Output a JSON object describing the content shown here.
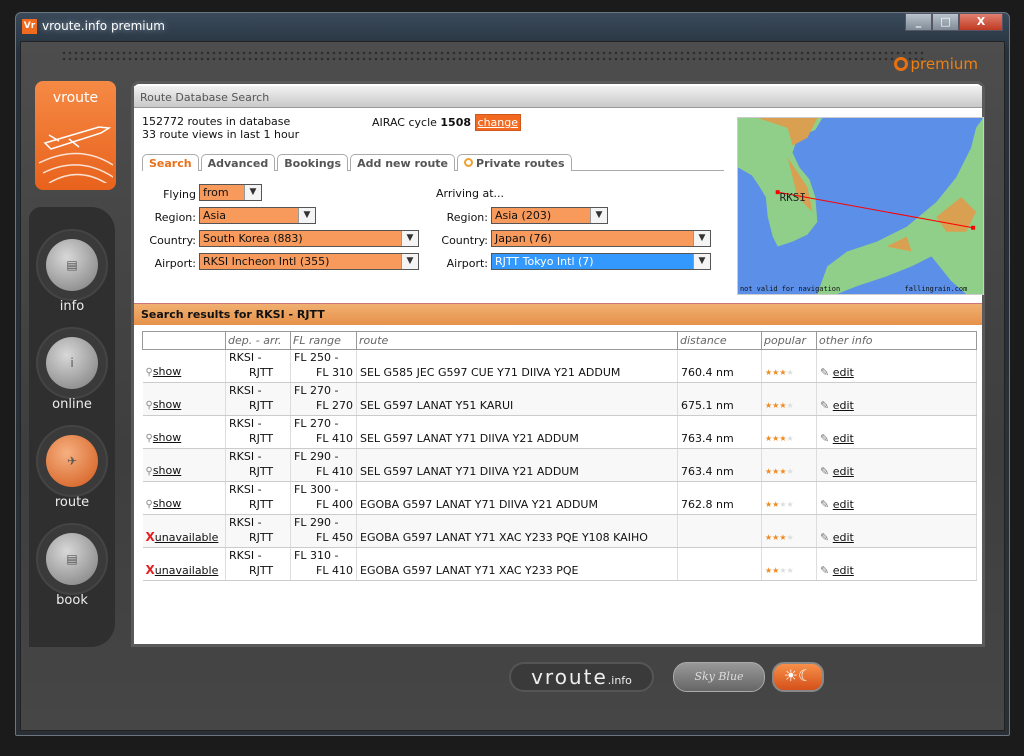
{
  "window": {
    "title": "vroute.info premium",
    "app_icon": "Vr",
    "min": "_",
    "max": "□",
    "close": "X"
  },
  "brand": {
    "premium": "premium",
    "tile": "vroute"
  },
  "nav": [
    {
      "label": "info",
      "icon": "info-book-icon",
      "glyph": "▤"
    },
    {
      "label": "online",
      "icon": "online-info-icon",
      "glyph": "i"
    },
    {
      "label": "route",
      "icon": "route-plane-icon",
      "glyph": "✈"
    },
    {
      "label": "book",
      "icon": "book-icon",
      "glyph": "▤"
    }
  ],
  "panel": {
    "title": "Route Database Search",
    "routes_count": "152772 routes in database",
    "views": "33 route views in last 1 hour",
    "airac_label": "AIRAC cycle",
    "airac_cycle": "1508",
    "change": "change"
  },
  "tabs": [
    "Search",
    "Advanced",
    "Bookings",
    "Add new route",
    "Private routes"
  ],
  "form": {
    "flying_label": "Flying",
    "flying_value": "from",
    "arriving_label": "Arriving at...",
    "region_label": "Region:",
    "country_label": "Country:",
    "airport_label": "Airport:",
    "dep_region": "Asia",
    "dep_country": "South Korea (883)",
    "dep_airport": "RKSI Incheon Intl (355)",
    "arr_region": "Asia (203)",
    "arr_country": "Japan (76)",
    "arr_airport": "RJTT Tokyo Intl (7)"
  },
  "map": {
    "label": "RKSI",
    "disclaimer": "not valid for navigation",
    "credit": "fallingrain.com"
  },
  "results": {
    "title": "Search results for RKSI - RJTT",
    "columns": [
      "",
      "dep. - arr.",
      "FL range",
      "route",
      "distance",
      "popular",
      "other info"
    ],
    "rows": [
      {
        "action": "show",
        "dep": "RKSI -",
        "arr": "RJTT",
        "fl_from": "FL 250 -",
        "fl_to": "FL 310",
        "route": "SEL G585 JEC G597 CUE Y71 DIIVA Y21 ADDUM",
        "distance": "760.4 nm",
        "stars": 3,
        "edit": "edit"
      },
      {
        "action": "show",
        "dep": "RKSI -",
        "arr": "RJTT",
        "fl_from": "FL 270 -",
        "fl_to": "FL 270",
        "route": "SEL G597 LANAT Y51 KARUI",
        "distance": "675.1 nm",
        "stars": 3,
        "edit": "edit"
      },
      {
        "action": "show",
        "dep": "RKSI -",
        "arr": "RJTT",
        "fl_from": "FL 270 -",
        "fl_to": "FL 410",
        "route": "SEL G597 LANAT Y71 DIIVA Y21 ADDUM",
        "distance": "763.4 nm",
        "stars": 3,
        "edit": "edit"
      },
      {
        "action": "show",
        "dep": "RKSI -",
        "arr": "RJTT",
        "fl_from": "FL 290 -",
        "fl_to": "FL 410",
        "route": "SEL G597 LANAT Y71 DIIVA Y21 ADDUM",
        "distance": "763.4 nm",
        "stars": 3,
        "edit": "edit"
      },
      {
        "action": "show",
        "dep": "RKSI -",
        "arr": "RJTT",
        "fl_from": "FL 300 -",
        "fl_to": "FL 400",
        "route": "EGOBA G597 LANAT Y71 DIIVA Y21 ADDUM",
        "distance": "762.8 nm",
        "stars": 2,
        "edit": "edit"
      },
      {
        "action": "unavailable",
        "dep": "RKSI -",
        "arr": "RJTT",
        "fl_from": "FL 290 -",
        "fl_to": "FL 450",
        "route": "EGOBA G597 LANAT Y71 XAC Y233 PQE Y108 KAIHO",
        "distance": "",
        "stars": 3,
        "edit": "edit"
      },
      {
        "action": "unavailable",
        "dep": "RKSI -",
        "arr": "RJTT",
        "fl_from": "FL 310 -",
        "fl_to": "FL 410",
        "route": "EGOBA G597 LANAT Y71 XAC Y233 PQE",
        "distance": "",
        "stars": 2,
        "edit": "edit"
      }
    ],
    "max_stars": 4
  },
  "footer": {
    "logo_main": "vroute",
    "logo_suffix": ".info",
    "skin": "Sky Blue",
    "toggle": "☀☾"
  },
  "colors": {
    "accent": "#f26a22",
    "select": "#f79a5c",
    "selected_blue": "#3399ff",
    "sea": "#5b8fe8"
  }
}
